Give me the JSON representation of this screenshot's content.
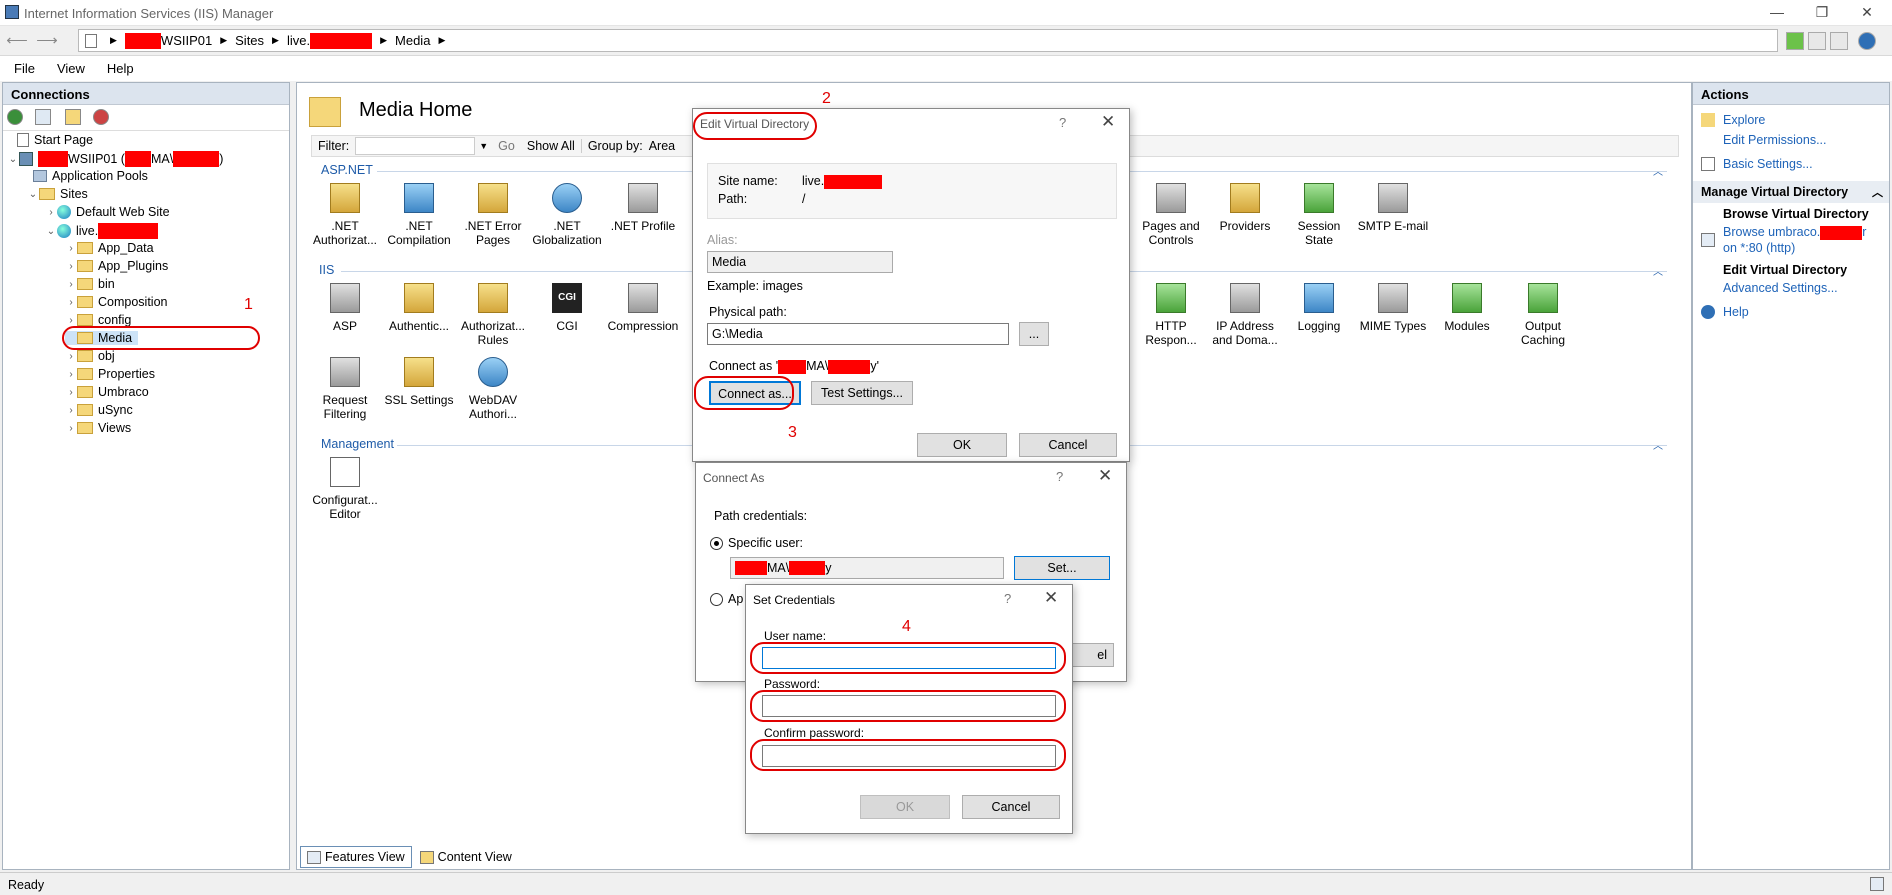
{
  "window": {
    "title": "Internet Information Services (IIS) Manager"
  },
  "address": {
    "segments": [
      "WSIIP01",
      "Sites",
      "live.",
      "Media"
    ]
  },
  "menu": [
    "File",
    "View",
    "Help"
  ],
  "connections": {
    "title": "Connections",
    "tree": [
      "Start Page",
      "WSIIP01 (",
      "MA\\",
      ")",
      "Application Pools",
      "Sites",
      "Default Web Site",
      "live.",
      "App_Data",
      "App_Plugins",
      "bin",
      "Composition",
      "config",
      "Media",
      "obj",
      "Properties",
      "Umbraco",
      "uSync",
      "Views"
    ]
  },
  "center": {
    "title": "Media Home",
    "filter_label": "Filter:",
    "go_label": "Go",
    "show_all": "Show All",
    "group_by": "Group by:",
    "group_value": "Area",
    "sections": [
      "ASP.NET",
      "IIS",
      "Management"
    ],
    "aspnet": [
      ".NET Authorizat...",
      ".NET Compilation",
      ".NET Error Pages",
      ".NET Globalization",
      ".NET Profile"
    ],
    "aspnet_right": [
      "Pages and Controls",
      "Providers",
      "Session State",
      "SMTP E-mail"
    ],
    "iis": [
      "ASP",
      "Authentic...",
      "Authorizat... Rules",
      "CGI",
      "Compression"
    ],
    "iis_right": [
      "HTTP Respon...",
      "IP Address and Doma...",
      "Logging",
      "MIME Types",
      "Modules",
      "Output Caching"
    ],
    "iis2": [
      "Request Filtering",
      "SSL Settings",
      "WebDAV Authori..."
    ],
    "management": [
      "Configurat... Editor"
    ]
  },
  "bottom_tabs": [
    "Features View",
    "Content View"
  ],
  "actions": {
    "title": "Actions",
    "items": [
      "Explore",
      "Edit Permissions...",
      "Basic Settings..."
    ],
    "section": "Manage Virtual Directory",
    "browse_head": "Browse Virtual Directory",
    "browse_link1": "Browse umbraco.",
    "browse_link1_end": "r",
    "browse_link2": "on *:80 (http)",
    "edit_head": "Edit Virtual Directory",
    "advanced": "Advanced Settings...",
    "help": "Help"
  },
  "status": "Ready",
  "edit_vd": {
    "title": "Edit Virtual Directory",
    "q": "?",
    "x": "✕",
    "site_name_label": "Site name:",
    "site_name_value": "live.",
    "path_label": "Path:",
    "path_value": "/",
    "alias_label": "Alias:",
    "alias_value": "Media",
    "example": "Example: images",
    "physical_label": "Physical path:",
    "physical_value": "G:\\Media",
    "browse_btn": "...",
    "connect_as_label": "Connect as '",
    "connect_as_mid": "MA\\",
    "connect_as_end": "y'",
    "connect_btn": "Connect as...",
    "test_btn": "Test Settings...",
    "ok": "OK",
    "cancel": "Cancel"
  },
  "connect_as": {
    "title": "Connect As",
    "q": "?",
    "x": "✕",
    "path_credentials": "Path credentials:",
    "specific_user": "Specific user:",
    "user_mid": "MA\\",
    "user_end": "y",
    "set_btn": "Set...",
    "app_user_partial": "Ap",
    "cancel_partial": "el"
  },
  "set_credentials": {
    "title": "Set Credentials",
    "q": "?",
    "x": "✕",
    "user_label": "User name:",
    "user_value": "",
    "password_label": "Password:",
    "password_value": "",
    "confirm_label": "Confirm password:",
    "confirm_value": "",
    "ok": "OK",
    "cancel": "Cancel"
  },
  "annotations": [
    "1",
    "2",
    "3",
    "4"
  ],
  "colors": {
    "annotation": "#e00000",
    "redaction": "#ff0000",
    "link": "#1e63b8",
    "focus": "#0078d7"
  }
}
